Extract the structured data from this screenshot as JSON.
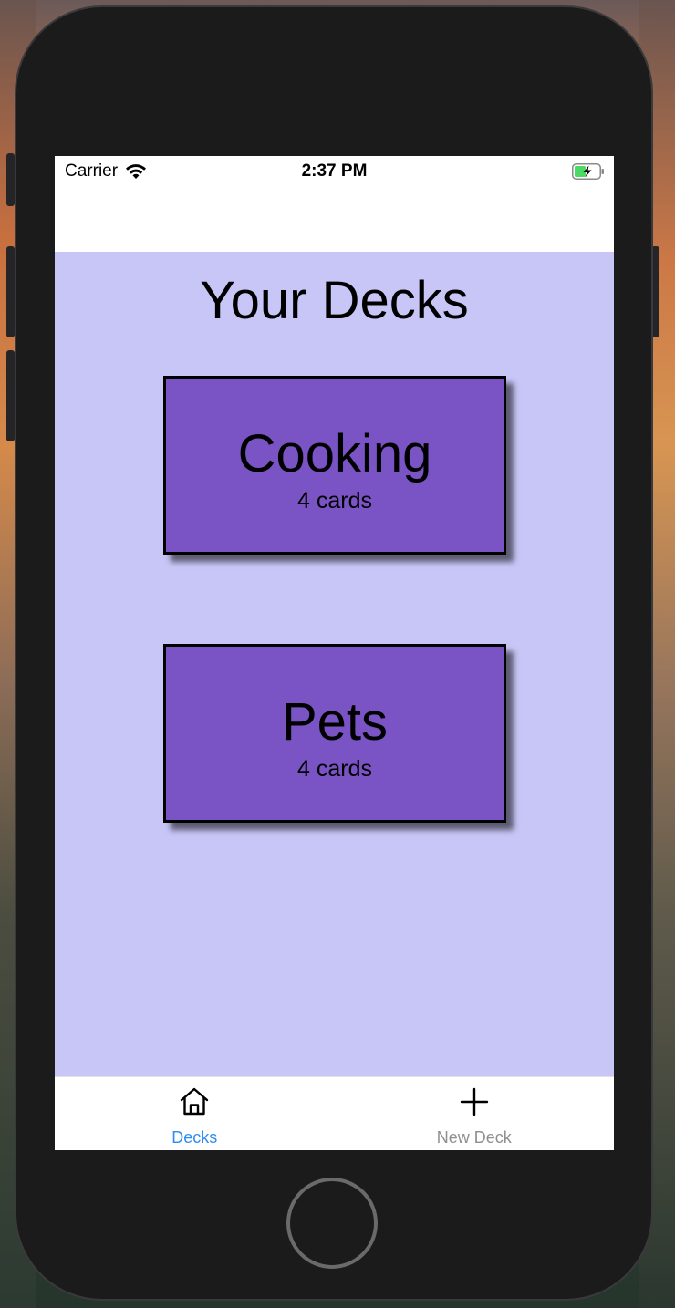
{
  "status_bar": {
    "carrier": "Carrier",
    "time": "2:37 PM",
    "icons": [
      "wifi-icon",
      "battery-charging-icon"
    ]
  },
  "main": {
    "title": "Your Decks",
    "background_color": "#c8c6f7",
    "deck_color": "#7a53c4",
    "decks": [
      {
        "name": "Cooking",
        "count_label": "4 cards"
      },
      {
        "name": "Pets",
        "count_label": "4 cards"
      }
    ]
  },
  "tab_bar": {
    "active_color": "#2f8cf0",
    "inactive_color": "#8e8e93",
    "tabs": [
      {
        "label": "Decks",
        "icon": "home-icon",
        "active": true
      },
      {
        "label": "New Deck",
        "icon": "plus-icon",
        "active": false
      }
    ]
  }
}
